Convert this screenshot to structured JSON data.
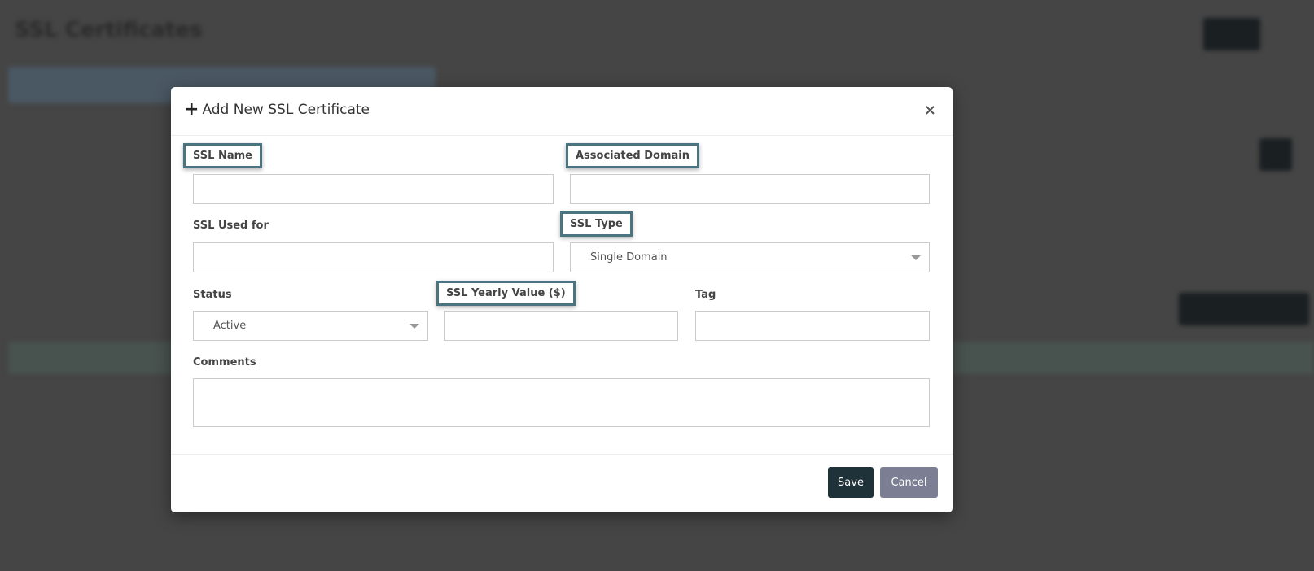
{
  "background": {
    "page_title": "SSL Certificates"
  },
  "modal": {
    "title": "Add New SSL Certificate",
    "title_icon": "plus-icon",
    "close_label": "×",
    "fields": {
      "ssl_name": {
        "label": "SSL Name",
        "value": ""
      },
      "associated_domain": {
        "label": "Associated Domain",
        "value": ""
      },
      "ssl_used_for": {
        "label": "SSL Used for",
        "value": ""
      },
      "ssl_type": {
        "label": "SSL Type",
        "value": "Single Domain"
      },
      "status": {
        "label": "Status",
        "value": "Active"
      },
      "ssl_yearly_value": {
        "label": "SSL Yearly Value ($)",
        "value": ""
      },
      "tag": {
        "label": "Tag",
        "value": ""
      },
      "comments": {
        "label": "Comments",
        "value": ""
      }
    },
    "save_label": "Save",
    "cancel_label": "Cancel"
  },
  "colors": {
    "highlight": "#4a7480",
    "save": "#1f3139",
    "cancel": "#7c7f94"
  }
}
